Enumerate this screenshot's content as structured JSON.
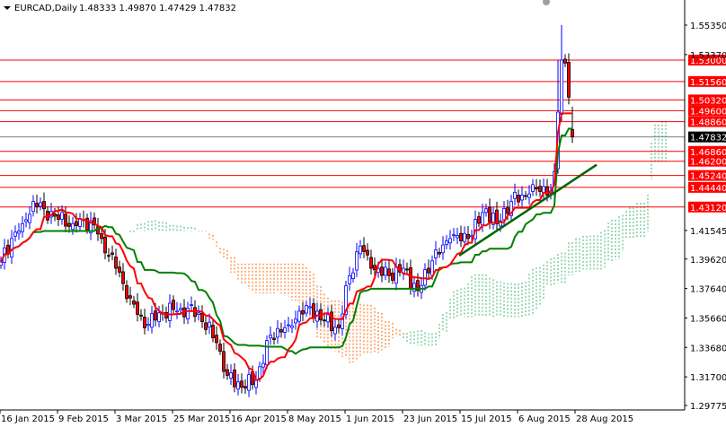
{
  "header": {
    "symbol_timeframe": "EURCAD,Daily",
    "ohlc": "1.48333 1.49870 1.47429 1.47832"
  },
  "colors": {
    "bull": "#0000FF",
    "bear": "#FF0000",
    "tenkan": "#FF0000",
    "kijun": "#008000",
    "cloud_bear": "#FF6600",
    "cloud_bull": "#3CB371",
    "level": "#FF0000",
    "current": "#708090",
    "trendline": "#006400"
  },
  "chart_data": {
    "type": "candlestick",
    "title": "EURCAD,Daily",
    "ylim": [
      1.29775,
      1.5535
    ],
    "y_ticks": [
      "1.55350",
      "1.53370",
      "1.41545",
      "1.39620",
      "1.37640",
      "1.35660",
      "1.33680",
      "1.31700",
      "1.29775"
    ],
    "x_ticks": [
      {
        "bar": 0,
        "label": "16 Jan 2015"
      },
      {
        "bar": 16,
        "label": "9 Feb 2015"
      },
      {
        "bar": 32,
        "label": "3 Mar 2015"
      },
      {
        "bar": 48,
        "label": "25 Mar 2015"
      },
      {
        "bar": 64,
        "label": "16 Apr 2015"
      },
      {
        "bar": 80,
        "label": "8 May 2015"
      },
      {
        "bar": 96,
        "label": "1 Jun 2015"
      },
      {
        "bar": 112,
        "label": "23 Jun 2015"
      },
      {
        "bar": 128,
        "label": "15 Jul 2015"
      },
      {
        "bar": 144,
        "label": "6 Aug 2015"
      },
      {
        "bar": 160,
        "label": "28 Aug 2015"
      }
    ],
    "bars": 160,
    "close_keypoints": [
      [
        0,
        1.395
      ],
      [
        3,
        1.41
      ],
      [
        6,
        1.42
      ],
      [
        9,
        1.435
      ],
      [
        12,
        1.43
      ],
      [
        15,
        1.425
      ],
      [
        20,
        1.42
      ],
      [
        25,
        1.422
      ],
      [
        28,
        1.41
      ],
      [
        32,
        1.39
      ],
      [
        36,
        1.37
      ],
      [
        40,
        1.35
      ],
      [
        44,
        1.36
      ],
      [
        50,
        1.363
      ],
      [
        55,
        1.36
      ],
      [
        60,
        1.34
      ],
      [
        63,
        1.318
      ],
      [
        67,
        1.31
      ],
      [
        71,
        1.315
      ],
      [
        75,
        1.345
      ],
      [
        80,
        1.352
      ],
      [
        85,
        1.365
      ],
      [
        90,
        1.355
      ],
      [
        94,
        1.35
      ],
      [
        97,
        1.385
      ],
      [
        100,
        1.405
      ],
      [
        103,
        1.39
      ],
      [
        108,
        1.385
      ],
      [
        112,
        1.39
      ],
      [
        116,
        1.375
      ],
      [
        120,
        1.395
      ],
      [
        125,
        1.41
      ],
      [
        130,
        1.41
      ],
      [
        135,
        1.43
      ],
      [
        138,
        1.42
      ],
      [
        142,
        1.435
      ],
      [
        147,
        1.44
      ],
      [
        151,
        1.445
      ],
      [
        153,
        1.442
      ],
      [
        154,
        1.455
      ],
      [
        155,
        1.495
      ],
      [
        156,
        1.53
      ],
      [
        157,
        1.528
      ],
      [
        158,
        1.505
      ],
      [
        159,
        1.478
      ]
    ],
    "last_bar": {
      "open": 1.48333,
      "high": 1.4987,
      "low": 1.47429,
      "close": 1.47832
    },
    "indicators": {
      "tenkan_period": 9,
      "kijun_period": 26,
      "senkou_b_period": 52,
      "shift": 26
    },
    "levels": [
      {
        "price": 1.53,
        "label": "1.53000"
      },
      {
        "price": 1.5156,
        "label": "1.51560"
      },
      {
        "price": 1.5032,
        "label": "1.50320"
      },
      {
        "price": 1.496,
        "label": "1.49600"
      },
      {
        "price": 1.4886,
        "label": "1.48860"
      },
      {
        "price": 1.4686,
        "label": "1.46860"
      },
      {
        "price": 1.462,
        "label": "1.46200"
      },
      {
        "price": 1.4524,
        "label": "1.45240"
      },
      {
        "price": 1.4444,
        "label": "1.44440"
      },
      {
        "price": 1.4312,
        "label": "1.43120"
      }
    ],
    "current_price": {
      "price": 1.47832,
      "label": "1.47832"
    },
    "trendline": [
      [
        127.5,
        1.3985
      ],
      [
        165.75,
        1.4596
      ]
    ]
  }
}
